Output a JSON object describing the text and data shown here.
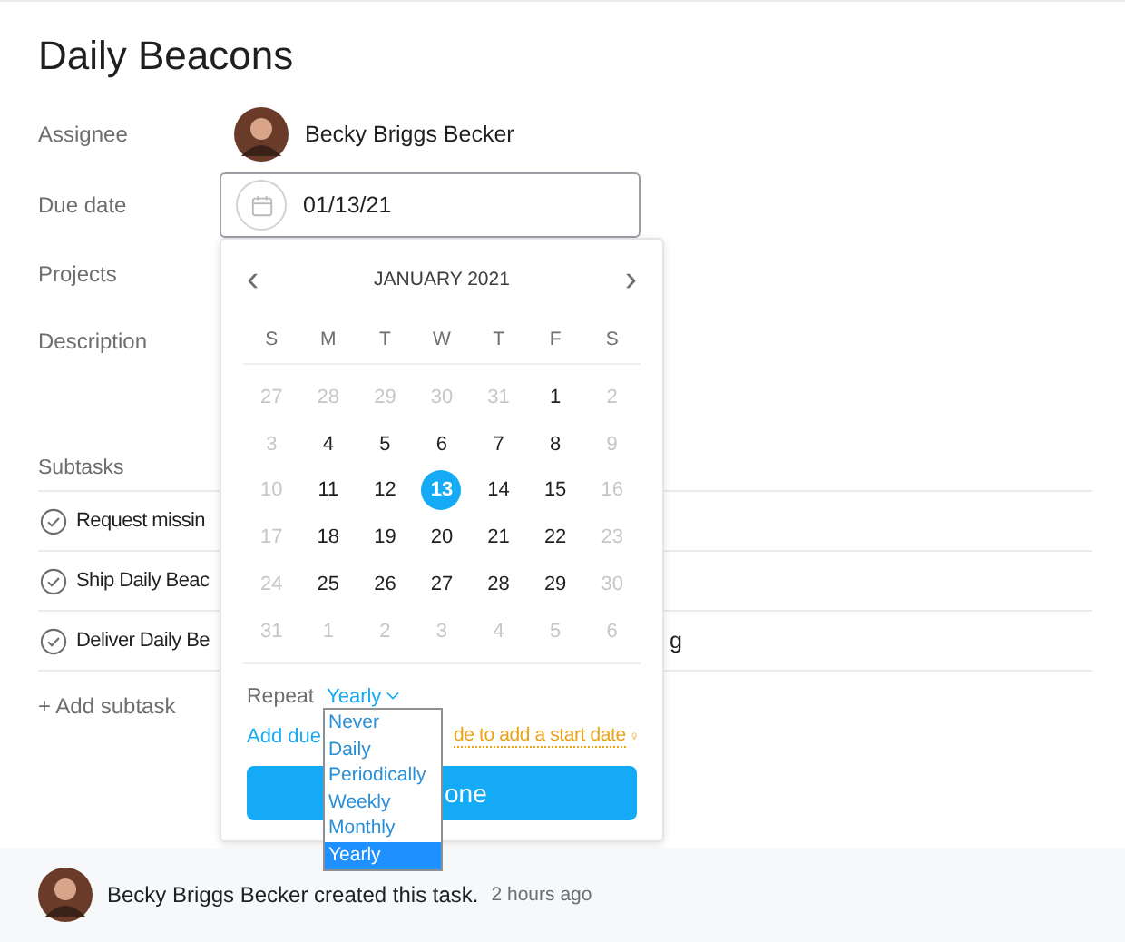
{
  "title": "Daily Beacons",
  "fields": [
    {
      "label": "Assignee",
      "kind": "person",
      "value": "Becky Briggs Becker"
    },
    {
      "label": "Due date",
      "kind": "date",
      "value": "01/13/21"
    },
    {
      "label": "Projects",
      "kind": "empty"
    },
    {
      "label": "Description",
      "kind": "empty"
    }
  ],
  "subtasks": {
    "label": "Subtasks",
    "items": [
      {
        "name": "Request missin"
      },
      {
        "name": "Ship Daily Beac"
      },
      {
        "name": "Deliver Daily Be",
        "tail": "g"
      }
    ],
    "add": "+ Add subtask"
  },
  "calendar": {
    "month": "JANUARY 2021",
    "prev": "‹",
    "next": "›",
    "weekdays": [
      "S",
      "M",
      "T",
      "W",
      "T",
      "F",
      "S"
    ],
    "days": [
      {
        "day": "27",
        "muted": true,
        "selected": false
      },
      {
        "day": "28",
        "muted": true,
        "selected": false
      },
      {
        "day": "29",
        "muted": true,
        "selected": false
      },
      {
        "day": "30",
        "muted": true,
        "selected": false
      },
      {
        "day": "31",
        "muted": true,
        "selected": false
      },
      {
        "day": "1",
        "muted": false,
        "selected": false
      },
      {
        "day": "2",
        "muted": true,
        "selected": false
      },
      {
        "day": "3",
        "muted": true,
        "selected": false
      },
      {
        "day": "4",
        "muted": false,
        "selected": false
      },
      {
        "day": "5",
        "muted": false,
        "selected": false
      },
      {
        "day": "6",
        "muted": false,
        "selected": false
      },
      {
        "day": "7",
        "muted": false,
        "selected": false
      },
      {
        "day": "8",
        "muted": false,
        "selected": false
      },
      {
        "day": "9",
        "muted": true,
        "selected": false
      },
      {
        "day": "10",
        "muted": true,
        "selected": false
      },
      {
        "day": "11",
        "muted": false,
        "selected": false
      },
      {
        "day": "12",
        "muted": false,
        "selected": false
      },
      {
        "day": "13",
        "muted": false,
        "selected": true
      },
      {
        "day": "14",
        "muted": false,
        "selected": false
      },
      {
        "day": "15",
        "muted": false,
        "selected": false
      },
      {
        "day": "16",
        "muted": true,
        "selected": false
      },
      {
        "day": "17",
        "muted": true,
        "selected": false
      },
      {
        "day": "18",
        "muted": false,
        "selected": false
      },
      {
        "day": "19",
        "muted": false,
        "selected": false
      },
      {
        "day": "20",
        "muted": false,
        "selected": false
      },
      {
        "day": "21",
        "muted": false,
        "selected": false
      },
      {
        "day": "22",
        "muted": false,
        "selected": false
      },
      {
        "day": "23",
        "muted": true,
        "selected": false
      },
      {
        "day": "24",
        "muted": true,
        "selected": false
      },
      {
        "day": "25",
        "muted": false,
        "selected": false
      },
      {
        "day": "26",
        "muted": false,
        "selected": false
      },
      {
        "day": "27",
        "muted": false,
        "selected": false
      },
      {
        "day": "28",
        "muted": false,
        "selected": false
      },
      {
        "day": "29",
        "muted": false,
        "selected": false
      },
      {
        "day": "30",
        "muted": true,
        "selected": false
      },
      {
        "day": "31",
        "muted": true,
        "selected": false
      },
      {
        "day": "1",
        "muted": true,
        "selected": false
      },
      {
        "day": "2",
        "muted": true,
        "selected": false
      },
      {
        "day": "3",
        "muted": true,
        "selected": false
      },
      {
        "day": "4",
        "muted": true,
        "selected": false
      },
      {
        "day": "5",
        "muted": true,
        "selected": false
      },
      {
        "day": "6",
        "muted": true,
        "selected": false
      }
    ],
    "repeat_label": "Repeat",
    "repeat_value": "Yearly",
    "options": [
      {
        "label": "Never",
        "selected": false
      },
      {
        "label": "Daily",
        "selected": false
      },
      {
        "label": "Periodically",
        "selected": false
      },
      {
        "label": "Weekly",
        "selected": false
      },
      {
        "label": "Monthly",
        "selected": false
      },
      {
        "label": "Yearly",
        "selected": true
      }
    ],
    "add_due": "Add due",
    "start_hint": "de to add a start date",
    "done": "one"
  },
  "activity": {
    "author": "Becky Briggs Becker created this task.",
    "time": "2 hours ago"
  }
}
